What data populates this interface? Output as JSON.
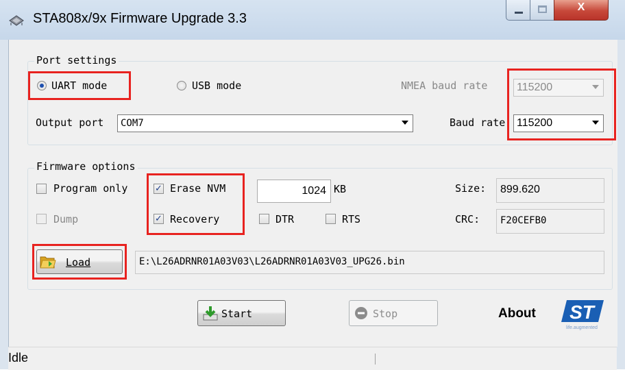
{
  "window": {
    "title": "STA808x/9x Firmware Upgrade 3.3",
    "close_glyph": "X"
  },
  "port_settings": {
    "title": "Port settings",
    "uart_label": "UART mode",
    "uart_selected": true,
    "usb_label": "USB mode",
    "usb_selected": false,
    "nmea_label": "NMEA baud rate",
    "nmea_value": "115200",
    "output_port_label": "Output port",
    "output_port_value": "COM7",
    "baud_label": "Baud rate",
    "baud_value": "115200"
  },
  "firmware_options": {
    "title": "Firmware options",
    "program_only_label": "Program only",
    "program_only_checked": false,
    "erase_nvm_label": "Erase NVM",
    "erase_nvm_checked": true,
    "nvm_size_value": "1024",
    "nvm_unit": "KB",
    "size_label": "Size:",
    "size_value": "899.620",
    "dump_label": "Dump",
    "dump_checked": false,
    "recovery_label": "Recovery",
    "recovery_checked": true,
    "dtr_label": "DTR",
    "dtr_checked": false,
    "rts_label": "RTS",
    "rts_checked": false,
    "crc_label": "CRC:",
    "crc_value": "F20CEFB0",
    "load_label": "Load",
    "file_path": "E:\\L26ADRNR01A03V03\\L26ADRNR01A03V03_UPG26.bin"
  },
  "actions": {
    "start_label": "Start",
    "stop_label": "Stop",
    "about_label": "About",
    "logo_text": "ST",
    "logo_tagline": "life.augmented"
  },
  "status": {
    "text": "Idle"
  },
  "colors": {
    "highlight": "#e8221f",
    "st_blue": "#1a5fb4"
  }
}
